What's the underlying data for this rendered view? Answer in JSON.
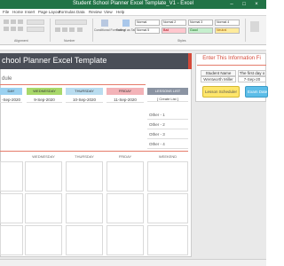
{
  "window": {
    "title": "Student School Planner Excel Template_V1  -  Excel"
  },
  "ribbon": {
    "tabs": [
      "File",
      "Home",
      "Insert",
      "Page Layout",
      "Formulas",
      "Data",
      "Review",
      "View",
      "Help"
    ],
    "groups": {
      "alignment": "Alignment",
      "number": "Number",
      "styles": "Styles"
    },
    "conditional_formatting": "Conditional Formatting",
    "format_as_table": "Format as Table",
    "style_cells": [
      {
        "label": "Normal",
        "color": "#ffffff"
      },
      {
        "label": "Normal 2",
        "color": "#ffffff"
      },
      {
        "label": "Normal 3",
        "color": "#ffffff"
      },
      {
        "label": "Normal 4",
        "color": "#ffffff"
      },
      {
        "label": "Normal 5",
        "color": "#ffffff"
      },
      {
        "label": "Bad",
        "color": "#ffc7ce"
      },
      {
        "label": "Good",
        "color": "#c6efce"
      },
      {
        "label": "Neutral",
        "color": "#ffeb9c"
      }
    ]
  },
  "planner": {
    "title": "chool Planner Excel Template",
    "schedule_label": "dule",
    "days": [
      {
        "label": "DAY",
        "date": "-Sep-2020",
        "color": "#9bd1f0"
      },
      {
        "label": "WEDNESDAY",
        "date": "9-Sep-2020",
        "color": "#a8d86a"
      },
      {
        "label": "THURSDAY",
        "date": "10-Sep-2020",
        "color": "#b9dcef"
      },
      {
        "label": "FRIDAY",
        "date": "11-Sep-2020",
        "color": "#f3b3b8"
      }
    ],
    "lessons": {
      "header": "LESSONS LIST",
      "create": "[ Create List ]",
      "items": [
        "Other - 1",
        "Other - 2",
        "Other - 3",
        "Other - 4"
      ]
    },
    "week_headers": [
      "",
      "WEDNESDAY",
      "THURSDAY",
      "FRIDAY",
      "WEEKEND"
    ]
  },
  "info_panel": {
    "title": "Enter This Information Fi",
    "headers": [
      "Student Name",
      "The first day o"
    ],
    "values": [
      "Wentworth Miller",
      "7-Sep-20"
    ],
    "scheduler_button": "Lesson Scheduler",
    "exam_button": "Exam Dates"
  }
}
